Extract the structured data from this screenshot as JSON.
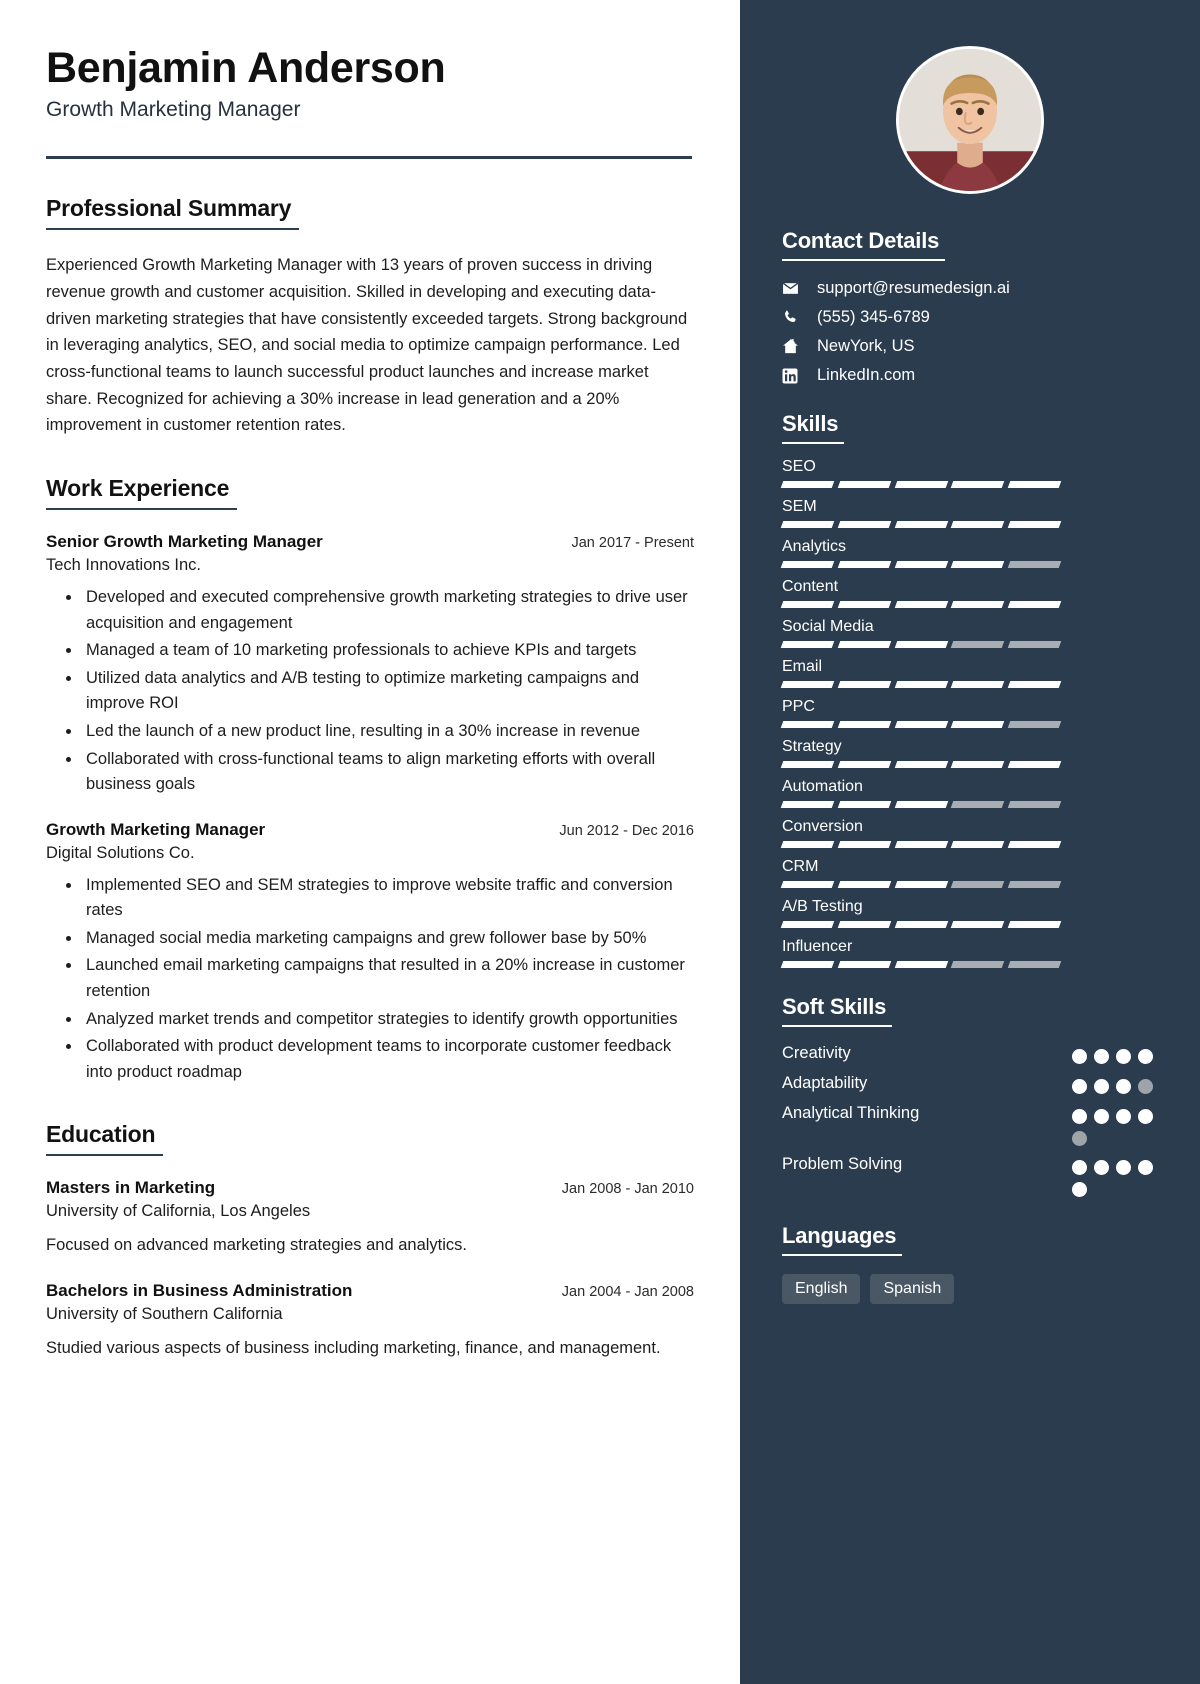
{
  "header": {
    "name": "Benjamin Anderson",
    "job_title": "Growth Marketing Manager"
  },
  "sections": {
    "summary_title": "Professional Summary",
    "summary_text": "Experienced Growth Marketing Manager with 13 years of proven success in driving revenue growth and customer acquisition. Skilled in developing and executing data-driven marketing strategies that have consistently exceeded targets. Strong background in leveraging analytics, SEO, and social media to optimize campaign performance. Led cross-functional teams to launch successful product launches and increase market share. Recognized for achieving a 30% increase in lead generation and a 20% improvement in customer retention rates.",
    "work_title": "Work Experience",
    "education_title": "Education"
  },
  "work_experience": [
    {
      "role": "Senior Growth Marketing Manager",
      "dates": "Jan 2017 - Present",
      "company": "Tech Innovations Inc.",
      "bullets": [
        "Developed and executed comprehensive growth marketing strategies to drive user acquisition and engagement",
        "Managed a team of 10 marketing professionals to achieve KPIs and targets",
        "Utilized data analytics and A/B testing to optimize marketing campaigns and improve ROI",
        "Led the launch of a new product line, resulting in a 30% increase in revenue",
        "Collaborated with cross-functional teams to align marketing efforts with overall business goals"
      ]
    },
    {
      "role": "Growth Marketing Manager",
      "dates": "Jun 2012 - Dec 2016",
      "company": "Digital Solutions Co.",
      "bullets": [
        "Implemented SEO and SEM strategies to improve website traffic and conversion rates",
        "Managed social media marketing campaigns and grew follower base by 50%",
        "Launched email marketing campaigns that resulted in a 20% increase in customer retention",
        "Analyzed market trends and competitor strategies to identify growth opportunities",
        "Collaborated with product development teams to incorporate customer feedback into product roadmap"
      ]
    }
  ],
  "education": [
    {
      "degree": "Masters in Marketing",
      "dates": "Jan 2008 - Jan 2010",
      "school": "University of California, Los Angeles",
      "description": "Focused on advanced marketing strategies and analytics."
    },
    {
      "degree": "Bachelors in Business Administration",
      "dates": "Jan 2004 - Jan 2008",
      "school": "University of Southern California",
      "description": "Studied various aspects of business including marketing, finance, and management."
    }
  ],
  "sidebar": {
    "contact_title": "Contact Details",
    "contact": [
      {
        "icon": "envelope-icon",
        "value": "support@resumedesign.ai"
      },
      {
        "icon": "phone-icon",
        "value": "(555) 345-6789"
      },
      {
        "icon": "home-icon",
        "value": "NewYork, US"
      },
      {
        "icon": "linkedin-icon",
        "value": "LinkedIn.com"
      }
    ],
    "skills_title": "Skills",
    "skills": [
      {
        "name": "SEO",
        "segments": 5,
        "filled": 5
      },
      {
        "name": "SEM",
        "segments": 5,
        "filled": 5
      },
      {
        "name": "Analytics",
        "segments": 5,
        "filled": 4
      },
      {
        "name": "Content",
        "segments": 5,
        "filled": 5
      },
      {
        "name": "Social Media",
        "segments": 5,
        "filled": 3
      },
      {
        "name": "Email",
        "segments": 5,
        "filled": 5
      },
      {
        "name": "PPC",
        "segments": 5,
        "filled": 4
      },
      {
        "name": "Strategy",
        "segments": 5,
        "filled": 5
      },
      {
        "name": "Automation",
        "segments": 5,
        "filled": 3
      },
      {
        "name": "Conversion",
        "segments": 5,
        "filled": 5
      },
      {
        "name": "CRM",
        "segments": 5,
        "filled": 3
      },
      {
        "name": "A/B Testing",
        "segments": 5,
        "filled": 5
      },
      {
        "name": "Influencer",
        "segments": 5,
        "filled": 3
      }
    ],
    "soft_skills_title": "Soft Skills",
    "soft_skills": [
      {
        "name": "Creativity",
        "total": 4,
        "filled": 4
      },
      {
        "name": "Adaptability",
        "total": 4,
        "filled": 3
      },
      {
        "name": "Analytical Thinking",
        "total": 5,
        "filled": 4
      },
      {
        "name": "Problem Solving",
        "total": 5,
        "filled": 5
      }
    ],
    "languages_title": "Languages",
    "languages": [
      "English",
      "Spanish"
    ]
  },
  "colors": {
    "sidebar_bg": "#2b3c4e",
    "accent_rule": "#2d3e50",
    "skill_filled": "#ffffff",
    "skill_empty": "#a9aeb2",
    "tag_bg": "#4a5865"
  }
}
